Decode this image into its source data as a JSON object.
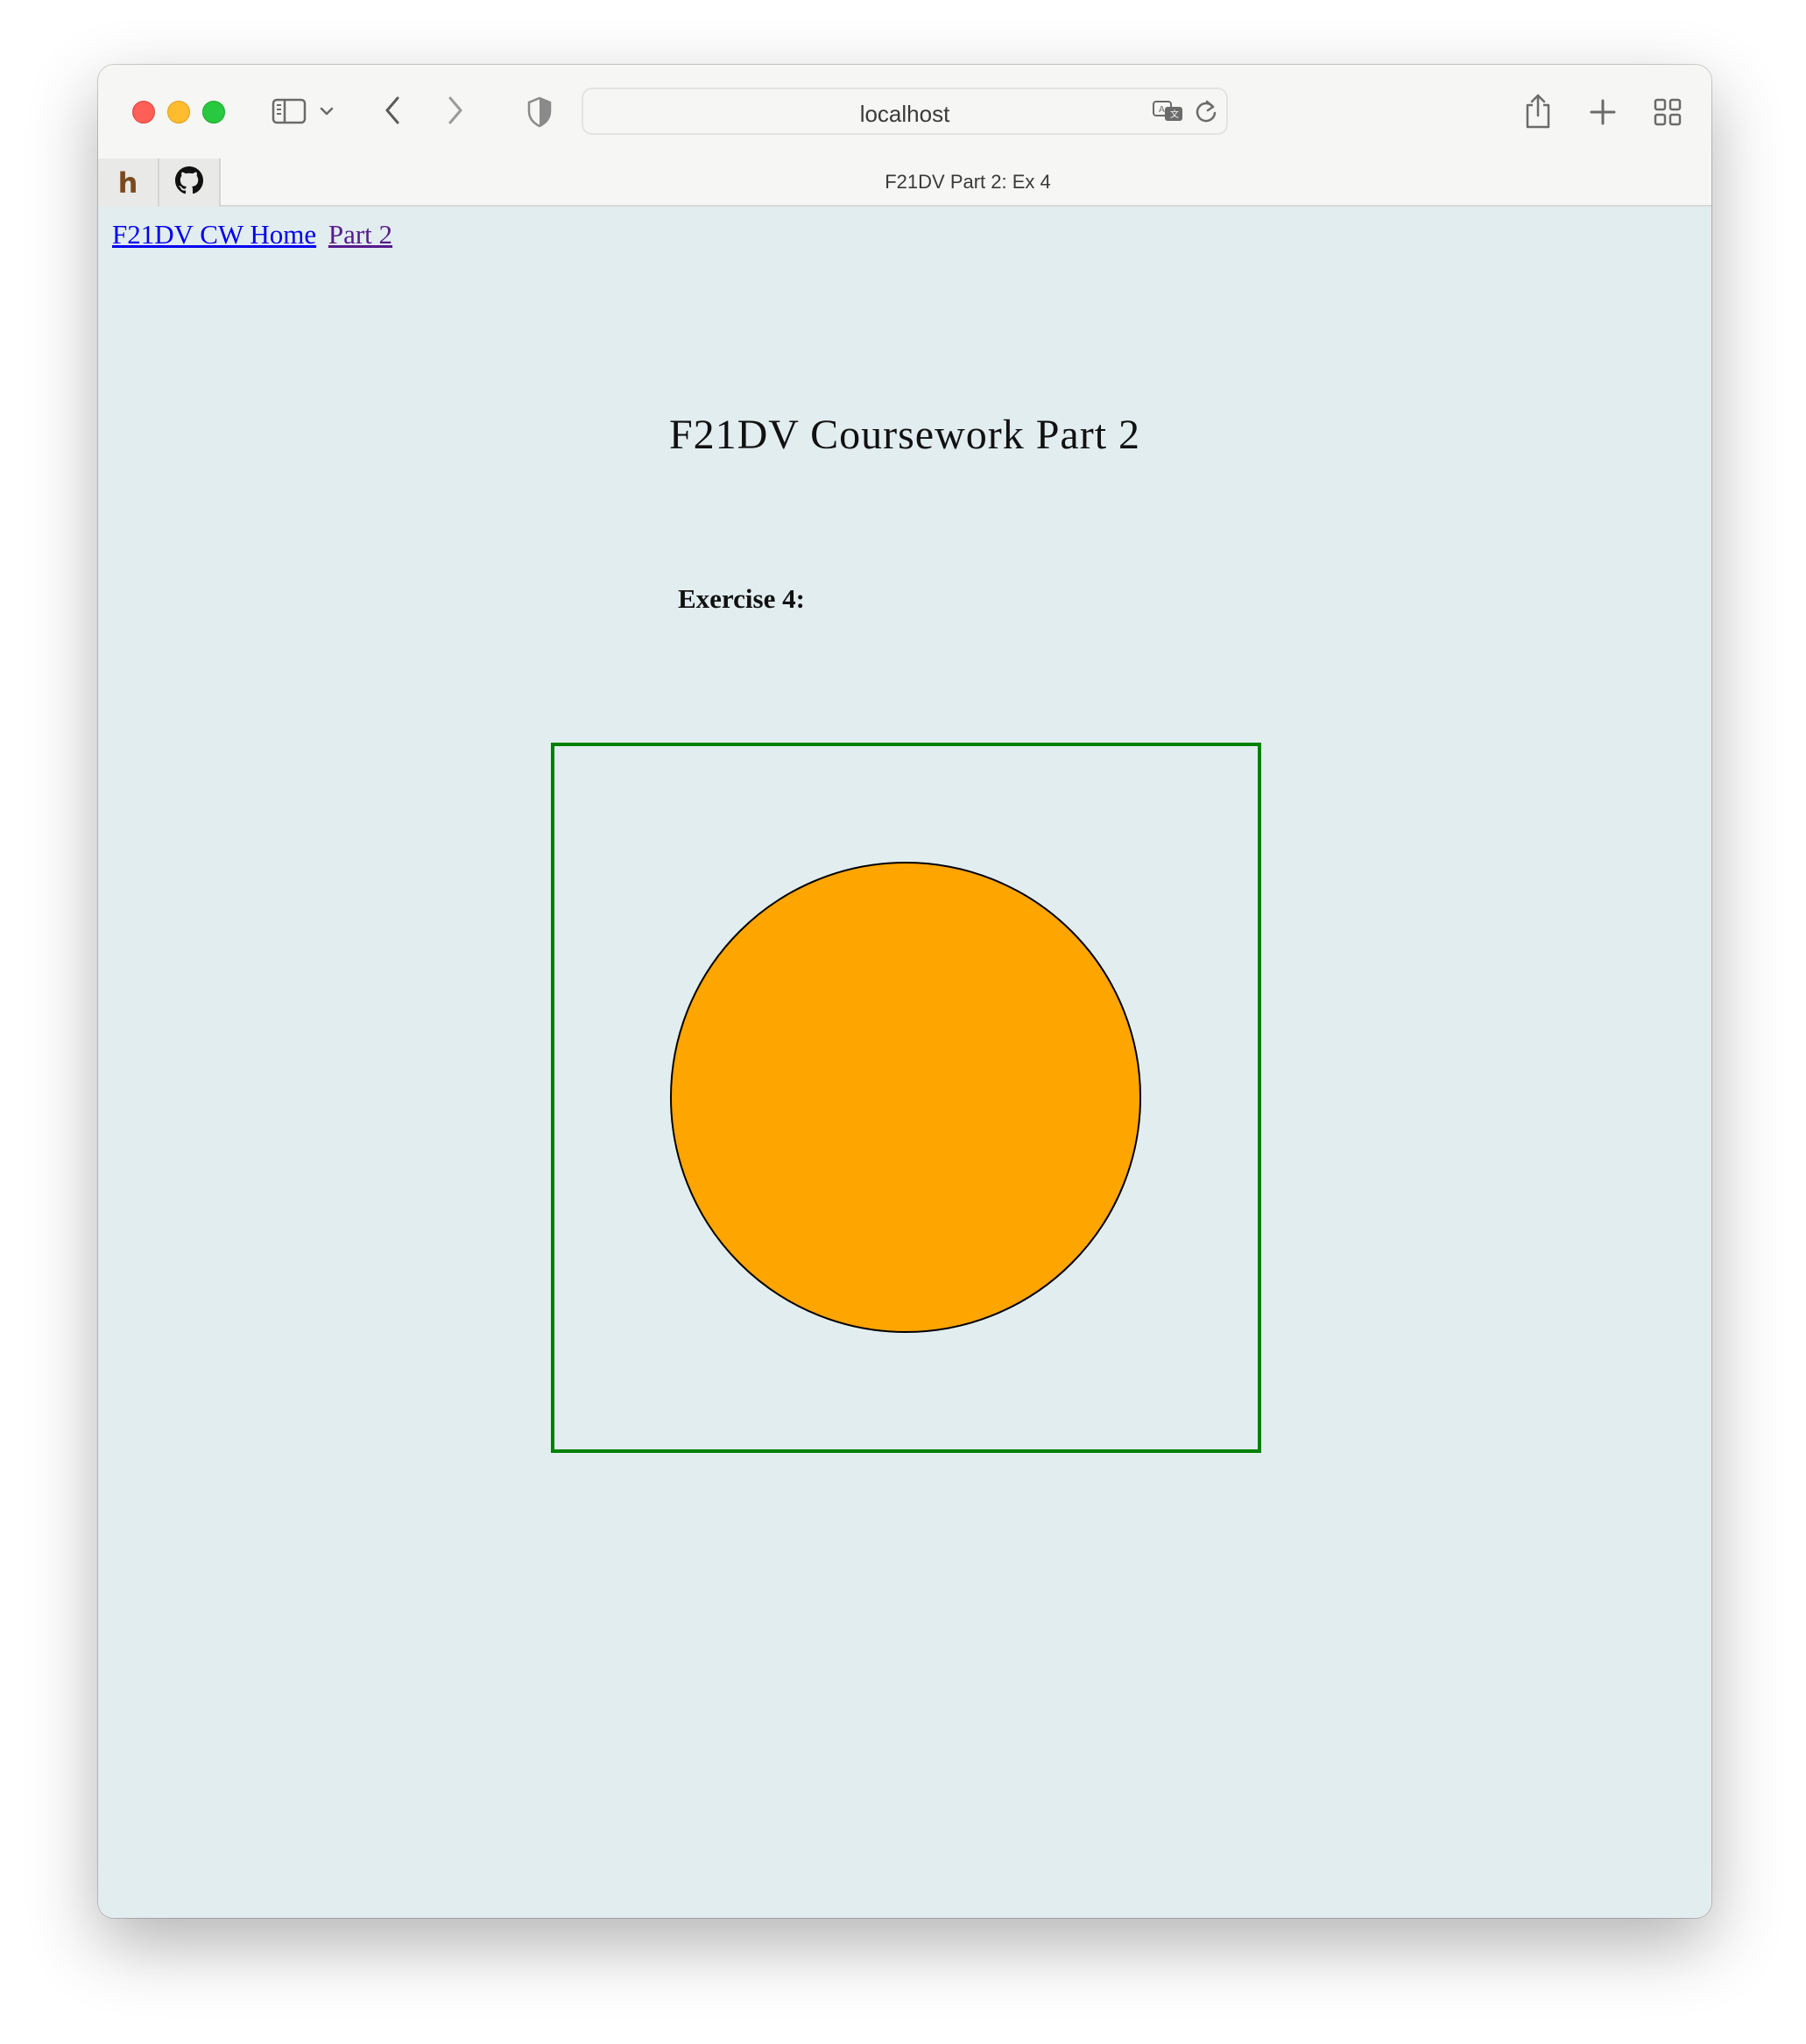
{
  "browser": {
    "address": "localhost",
    "tab_title": "F21DV Part 2: Ex 4",
    "pinned_tabs": [
      {
        "name": "h",
        "icon": "h-favicon-icon"
      },
      {
        "name": "github",
        "icon": "github-icon"
      }
    ]
  },
  "nav": {
    "home_link": "F21DV CW Home",
    "part_link": "Part 2"
  },
  "page": {
    "title": "F21DV Coursework Part 2",
    "exercise_heading": "Exercise 4:"
  },
  "drawing": {
    "frame_color": "#008000",
    "circle_fill": "#ffa500",
    "circle_stroke": "#000000"
  },
  "colors": {
    "background": "#e2edef",
    "link": "#0000ee",
    "visited_link": "#551a8b"
  }
}
